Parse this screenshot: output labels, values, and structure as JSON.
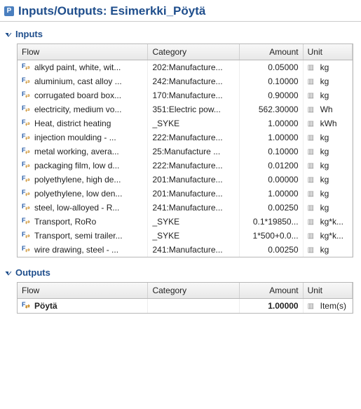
{
  "title_prefix": "Inputs/Outputs: ",
  "title_name": "Esimerkki_Pöytä",
  "title_icon_letter": "P",
  "sections": {
    "inputs": {
      "label": "Inputs"
    },
    "outputs": {
      "label": "Outputs"
    }
  },
  "columns": {
    "flow": "Flow",
    "category": "Category",
    "amount": "Amount",
    "unit": "Unit"
  },
  "inputs": [
    {
      "flow": "alkyd paint, white, wit...",
      "category": "202:Manufacture...",
      "amount": "0.05000",
      "unit": "kg"
    },
    {
      "flow": "aluminium, cast alloy ...",
      "category": "242:Manufacture...",
      "amount": "0.10000",
      "unit": "kg"
    },
    {
      "flow": "corrugated board box...",
      "category": "170:Manufacture...",
      "amount": "0.90000",
      "unit": "kg"
    },
    {
      "flow": "electricity, medium vo...",
      "category": "351:Electric pow...",
      "amount": "562.30000",
      "unit": "Wh"
    },
    {
      "flow": "Heat, district heating",
      "category": "_SYKE",
      "amount": "1.00000",
      "unit": "kWh"
    },
    {
      "flow": "injection moulding - ...",
      "category": "222:Manufacture...",
      "amount": "1.00000",
      "unit": "kg"
    },
    {
      "flow": "metal working, avera...",
      "category": "25:Manufacture ...",
      "amount": "0.10000",
      "unit": "kg"
    },
    {
      "flow": "packaging film, low d...",
      "category": "222:Manufacture...",
      "amount": "0.01200",
      "unit": "kg"
    },
    {
      "flow": "polyethylene, high de...",
      "category": "201:Manufacture...",
      "amount": "0.00000",
      "unit": "kg"
    },
    {
      "flow": "polyethylene, low den...",
      "category": "201:Manufacture...",
      "amount": "1.00000",
      "unit": "kg"
    },
    {
      "flow": "steel, low-alloyed - R...",
      "category": "241:Manufacture...",
      "amount": "0.00250",
      "unit": "kg"
    },
    {
      "flow": "Transport, RoRo",
      "category": "_SYKE",
      "amount": "0.1*19850...",
      "unit": "kg*k..."
    },
    {
      "flow": "Transport, semi trailer...",
      "category": "_SYKE",
      "amount": "1*500+0.0...",
      "unit": "kg*k..."
    },
    {
      "flow": "wire drawing, steel - ...",
      "category": "241:Manufacture...",
      "amount": "0.00250",
      "unit": "kg"
    }
  ],
  "outputs": [
    {
      "flow": "Pöytä",
      "category": "",
      "amount": "1.00000",
      "unit": "Item(s)",
      "bold": true
    }
  ],
  "icons": {
    "ruler": "▥"
  }
}
